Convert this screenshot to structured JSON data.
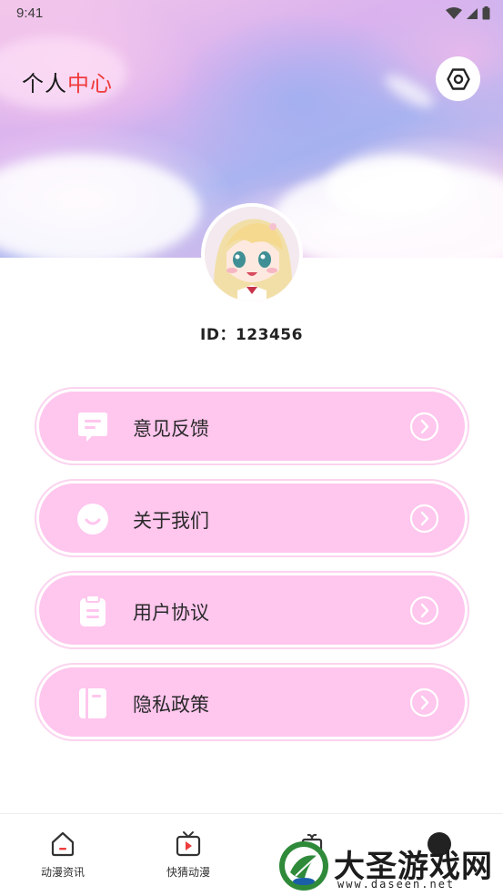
{
  "status_bar": {
    "time": "9:41"
  },
  "header": {
    "title_plain": "个人",
    "title_accent": "中心",
    "settings_icon": "settings-hexagon-icon"
  },
  "profile": {
    "id_label": "ID：123456"
  },
  "menu": {
    "items": [
      {
        "label": "意见反馈",
        "icon": "feedback-message-icon"
      },
      {
        "label": "关于我们",
        "icon": "smile-icon"
      },
      {
        "label": "用户协议",
        "icon": "clipboard-icon"
      },
      {
        "label": "隐私政策",
        "icon": "notebook-icon"
      }
    ]
  },
  "bottom_nav": {
    "items": [
      {
        "label": "动漫资讯",
        "icon": "home-icon"
      },
      {
        "label": "快猜动漫",
        "icon": "tv-play-icon"
      }
    ]
  },
  "watermark": {
    "text": "大圣游戏网",
    "url": "www.daseen.net"
  },
  "colors": {
    "accent_red": "#ef3b3b",
    "pill_pink": "#ffc6ee",
    "pill_border": "#fbd3ef"
  }
}
